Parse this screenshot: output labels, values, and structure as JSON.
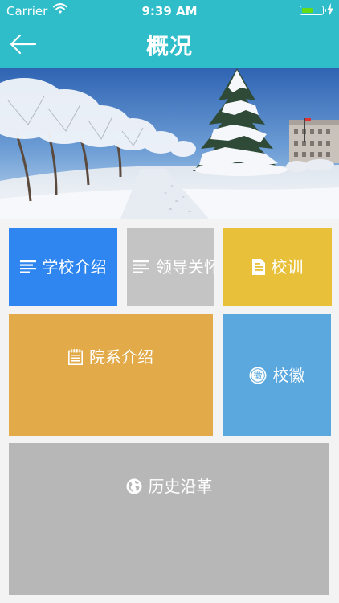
{
  "status_bar": {
    "carrier": "Carrier",
    "time": "9:39 AM",
    "battery_color": "#64dd17"
  },
  "nav": {
    "title": "概况",
    "back_icon": "arrow-left-icon",
    "bar_color": "#2fbdc9"
  },
  "hero": {
    "image": "snowy-campus-photo"
  },
  "tiles": {
    "school_intro": {
      "label": "学校介绍",
      "icon": "list-lines-icon",
      "color": "#2f86f0"
    },
    "leadership": {
      "label": "领导关怀",
      "icon": "list-lines-icon",
      "color": "#c4c4c4"
    },
    "motto": {
      "label": "校训",
      "icon": "document-icon",
      "color": "#e8c039"
    },
    "departments": {
      "label": "院系介绍",
      "icon": "notepad-icon",
      "color": "#e2aa48"
    },
    "emblem": {
      "label": "校徽",
      "icon": "badge-icon",
      "icon_text": "徽",
      "color": "#5ba8df"
    },
    "history": {
      "label": "历史沿革",
      "icon": "globe-icon",
      "color": "#b7b7b7"
    }
  }
}
